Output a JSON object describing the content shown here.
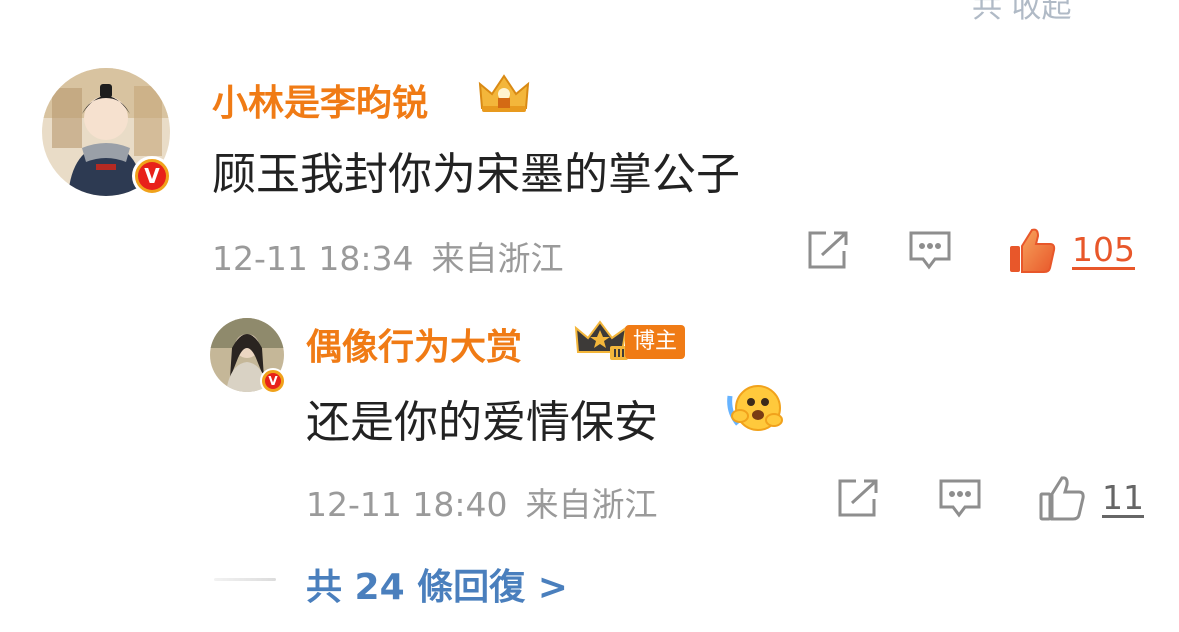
{
  "header_cut": {
    "text": "共 收起"
  },
  "comment": {
    "username": "小林是李昀锐",
    "content": "顾玉我封你为宋墨的掌公子",
    "date": "12-11 18:34",
    "location": "来自浙江",
    "like_count": "105",
    "verified_badge": "V",
    "liked": true,
    "icons": [
      "share-icon",
      "comment-icon",
      "like-icon"
    ]
  },
  "reply": {
    "username": "偶像行为大赏",
    "tag": "博主",
    "content": "还是你的爱情保安",
    "date": "12-11 18:40",
    "location": "来自浙江",
    "like_count": "11",
    "verified_badge": "V",
    "liked": false,
    "icons": [
      "share-icon",
      "comment-icon",
      "like-icon"
    ]
  },
  "more_replies": {
    "label": "共 24 條回復 >"
  },
  "colors": {
    "username": "#f07b15",
    "link": "#4a7fbd",
    "meta": "#9a9a9a",
    "liked": "#e8572a"
  }
}
